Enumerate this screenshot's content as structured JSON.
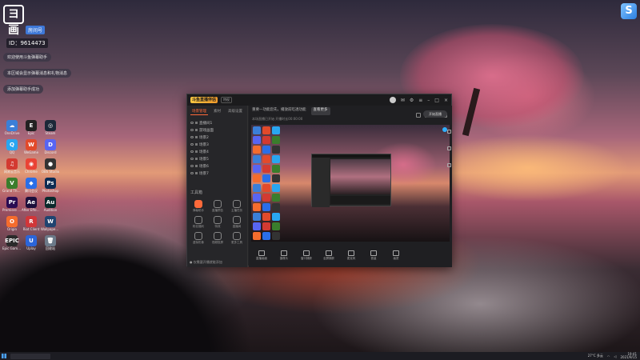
{
  "desktop": {
    "profile": {
      "logo_text": "ヨ画",
      "badge": "房间号",
      "room_id": "ID：9614473"
    },
    "chat_lines": [
      "欢迎使用斗鱼弹幕助手",
      "本区域会显示弹幕消息和礼物消息",
      "添加弹幕助手成功"
    ],
    "top_right_app": "S",
    "icons": [
      {
        "label": "OneDrive",
        "color": "#3b7fd8",
        "glyph": "☁"
      },
      {
        "label": "Epic",
        "color": "#222",
        "glyph": "E"
      },
      {
        "label": "Steam",
        "color": "#1b2838",
        "glyph": "◎"
      },
      {
        "label": "QQ",
        "color": "#29a6f0",
        "glyph": "Q"
      },
      {
        "label": "WeGame",
        "color": "#e24a2b",
        "glyph": "W"
      },
      {
        "label": "Discord",
        "color": "#5865f2",
        "glyph": "D"
      },
      {
        "label": "网易云音乐",
        "color": "#d33a31",
        "glyph": "♫"
      },
      {
        "label": "Chrome",
        "color": "#ea4335",
        "glyph": "◉"
      },
      {
        "label": "OBS Studio",
        "color": "#333",
        "glyph": "●"
      },
      {
        "label": "Grand Theft Auto V",
        "color": "#3a7d2c",
        "glyph": "V"
      },
      {
        "label": "腾讯会议",
        "color": "#2a6ee8",
        "glyph": "◆"
      },
      {
        "label": "Photoshop",
        "color": "#0d2b52",
        "glyph": "Ps"
      },
      {
        "label": "Premiere Pro",
        "color": "#2a0b52",
        "glyph": "Pr"
      },
      {
        "label": "After Effects",
        "color": "#1c0e3a",
        "glyph": "Ae"
      },
      {
        "label": "Audition",
        "color": "#0b2a2c",
        "glyph": "Au"
      },
      {
        "label": "Origin",
        "color": "#f56c2d",
        "glyph": "O"
      },
      {
        "label": "Riot Client",
        "color": "#d13639",
        "glyph": "R"
      },
      {
        "label": "Wallpaper Engine",
        "color": "#204470",
        "glyph": "W"
      },
      {
        "label": "Epic Games Launcher",
        "color": "#2a2a2a",
        "glyph": "EPIC"
      },
      {
        "label": "Uplay",
        "color": "#2b65d9",
        "glyph": "U"
      },
      {
        "label": "回收站",
        "color": "#6c7a89",
        "glyph": "🗑"
      }
    ]
  },
  "app": {
    "logo": "斗鱼直播伴侣",
    "title_tag": "特权",
    "tabs": [
      "场景管理",
      "素材",
      "高级设置"
    ],
    "scenes": [
      "直播间1",
      "游戏画面",
      "场景2",
      "场景3",
      "场景4",
      "场景5",
      "场景6",
      "场景7"
    ],
    "toolbox_title": "工具箱",
    "tools": [
      {
        "label": "弹幕助手",
        "hot": true
      },
      {
        "label": "直播预告",
        "hot": false
      },
      {
        "label": "主播任务",
        "hot": false
      },
      {
        "label": "粉丝福利",
        "hot": false
      },
      {
        "label": "特效",
        "hot": false
      },
      {
        "label": "直播间",
        "hot": false
      },
      {
        "label": "虚拟形象",
        "hot": false
      },
      {
        "label": "视频投屏",
        "hot": false
      },
      {
        "label": "更多工具",
        "hot": false
      }
    ],
    "footer_note": "● 仅需要开播就能添加",
    "header_text": "重要—功能您先，播放前吃透功能",
    "header_btn": "查看更多",
    "sub_text": "本场直播已开始 开播时长00:00:00",
    "bottom_items": [
      "直播画面",
      "摄像头",
      "窗口捕获",
      "全屏捕获",
      "麦克风",
      "音量",
      "画质"
    ],
    "live_button": "开始直播"
  },
  "taskbar": {
    "tray_text": "27°C 多云",
    "time": "19:41",
    "date": "2021/9/15"
  }
}
